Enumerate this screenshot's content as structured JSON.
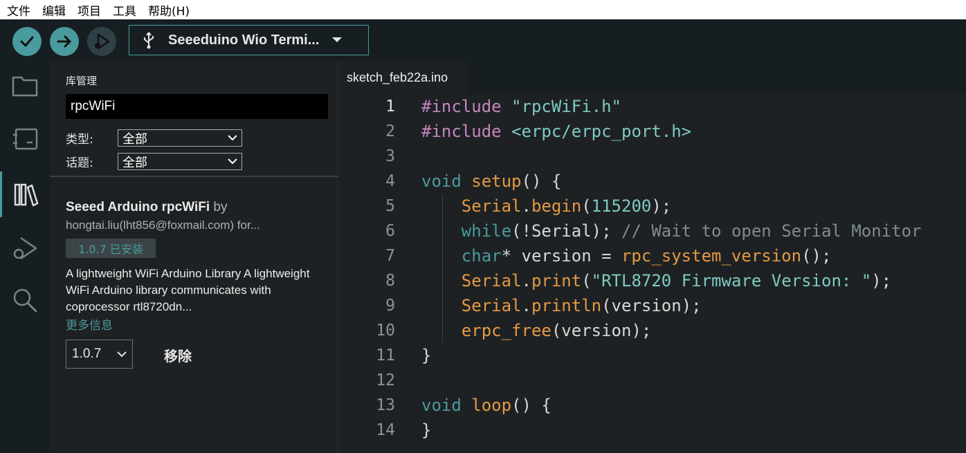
{
  "menu": [
    "文件",
    "编辑",
    "项目",
    "工具",
    "帮助(H)"
  ],
  "toolbar": {
    "board_label": "Seeeduino Wio Termi..."
  },
  "library": {
    "title": "库管理",
    "search_value": "rpcWiFi",
    "type_label": "类型:",
    "type_value": "全部",
    "topic_label": "话题:",
    "topic_value": "全部",
    "item": {
      "name": "Seeed Arduino rpcWiFi",
      "by": " by",
      "author": "hongtai.liu(lht856@foxmail.com) for...",
      "installed_badge": "1.0.7 已安装",
      "description": "A lightweight WiFi Arduino Library A lightweight WiFi Arduino library communicates with coprocessor rtl8720dn...",
      "more_info": "更多信息",
      "version": "1.0.7",
      "remove_label": "移除"
    }
  },
  "editor": {
    "tab_name": "sketch_feb22a.ino",
    "line_numbers": [
      "1",
      "2",
      "3",
      "4",
      "5",
      "6",
      "7",
      "8",
      "9",
      "10",
      "11",
      "12",
      "13",
      "14"
    ],
    "active_line": 1
  },
  "colors": {
    "accent": "#4a9b9d",
    "background": "#1e2123",
    "toolbar": "#171e21"
  }
}
